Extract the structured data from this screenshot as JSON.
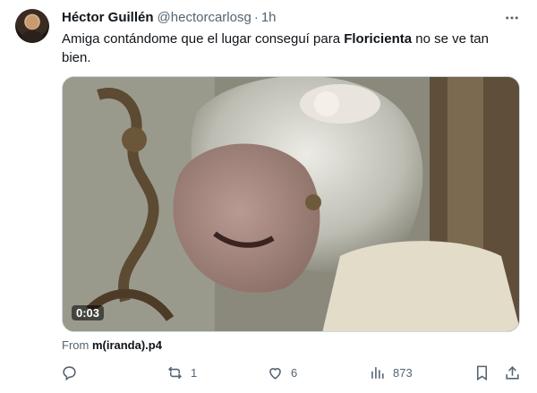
{
  "tweet": {
    "author_name": "Héctor Guillén",
    "handle": "@hectorcarlosg",
    "separator": "·",
    "time": "1h",
    "text_before": "Amiga contándome que el lugar conseguí para ",
    "text_bold": "Floricienta",
    "text_after": " no se ve tan bien.",
    "video_duration": "0:03",
    "source_prefix": "From ",
    "source_name": "m(iranda).p4"
  },
  "actions": {
    "reply_count": "",
    "retweet_count": "1",
    "like_count": "6",
    "views_count": "873"
  },
  "icons": {
    "more": "more-horizontal-icon",
    "reply": "reply-icon",
    "retweet": "retweet-icon",
    "like": "heart-icon",
    "views": "views-chart-icon",
    "bookmark": "bookmark-icon",
    "share": "share-icon"
  },
  "colors": {
    "text_primary": "#0f1419",
    "text_secondary": "#536471",
    "border": "#cfd9de"
  }
}
